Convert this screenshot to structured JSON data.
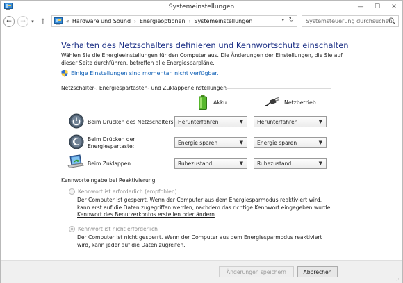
{
  "window": {
    "title": "Systemeinstellungen"
  },
  "nav": {
    "breadcrumb": [
      "Hardware und Sound",
      "Energieoptionen",
      "Systemeinstellungen"
    ],
    "search_placeholder": "Systemsteuerung durchsuchen"
  },
  "page": {
    "heading": "Verhalten des Netzschalters definieren und Kennwortschutz einschalten",
    "intro": "Wählen Sie die Energieeinstellungen für den Computer aus. Die Änderungen der Einstellungen, die Sie auf dieser Seite durchführen, betreffen alle Energiesparpläne.",
    "unavailable_link": "Einige Einstellungen sind momentan nicht verfügbar."
  },
  "buttons_section": {
    "title": "Netzschalter-, Energiespartasten- und Zuklappeneinstellungen",
    "columns": {
      "battery": "Akku",
      "plugged": "Netzbetrieb"
    },
    "rows": [
      {
        "label": "Beim Drücken des Netzschalters:",
        "battery": "Herunterfahren",
        "plugged": "Herunterfahren"
      },
      {
        "label_line1": "Beim Drücken der",
        "label_line2": "Energiespartaste:",
        "battery": "Energie sparen",
        "plugged": "Energie sparen"
      },
      {
        "label": "Beim Zuklappen:",
        "battery": "Ruhezustand",
        "plugged": "Ruhezustand"
      }
    ]
  },
  "password_section": {
    "title": "Kennworteingabe bei Reaktivierung",
    "option_required": {
      "label": "Kennwort ist erforderlich (empfohlen)",
      "desc": "Der Computer ist gesperrt. Wenn der Computer aus dem Energiesparmodus reaktiviert wird, kann erst auf die Daten zugegriffen werden, nachdem das richtige Kennwort eingegeben wurde.",
      "link": "Kennwort des Benutzerkontos erstellen oder ändern"
    },
    "option_not_required": {
      "label": "Kennwort ist nicht erforderlich",
      "desc": "Der Computer ist nicht gesperrt. Wenn der Computer aus dem Energiesparmodus reaktiviert wird, kann jeder auf die Daten zugreifen."
    }
  },
  "footer": {
    "save": "Änderungen speichern",
    "cancel": "Abbrechen"
  }
}
